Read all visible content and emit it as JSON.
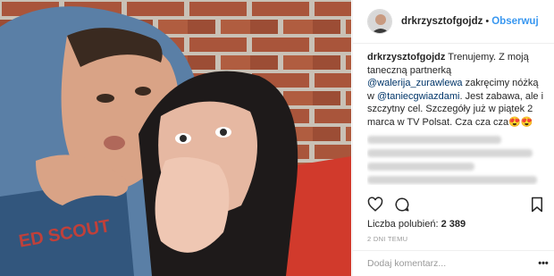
{
  "post": {
    "username": "drkrzysztofgojdz",
    "follow_label": "Obserwuj",
    "separator": "•",
    "caption": {
      "username": "drkrzysztofgojdz",
      "parts": [
        {
          "text": " Trenujemy. Z moją taneczną partnerką ",
          "mention": false
        },
        {
          "text": "@walerija_zurawlewa",
          "mention": true
        },
        {
          "text": " zakręcimy nóżką w ",
          "mention": false
        },
        {
          "text": "@taniecgwiazdami",
          "mention": true
        },
        {
          "text": ". Jest zabawa, ale i szczytny cel. Szczegóły już w piątek 2 marca w TV Polsat. Cza cza cza😍😍",
          "mention": false
        }
      ]
    },
    "likes_label": "Liczba polubień:",
    "likes_count": "2 389",
    "date": "2 DNI TEMU",
    "comment_placeholder": "Dodaj komentarz...",
    "more_label": "•••"
  },
  "icons": {
    "like": "heart-icon",
    "comment": "comment-icon",
    "save": "bookmark-icon",
    "more": "more-options-icon"
  },
  "colors": {
    "follow": "#3897f0",
    "mention": "#003569",
    "muted": "#999999",
    "border": "#efefef"
  }
}
